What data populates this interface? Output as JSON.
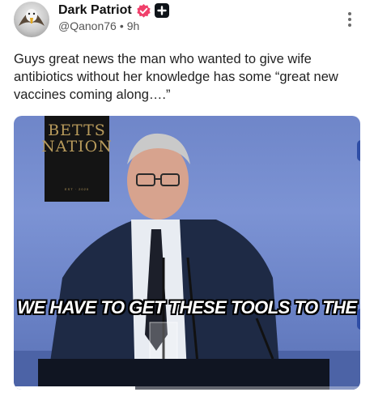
{
  "author": {
    "display_name": "Dark Patriot",
    "handle": "@Qanon76",
    "separator": "•",
    "time_ago": "9h",
    "avatar_icon": "eagle-avatar-icon",
    "verified_icon": "verified-badge-icon",
    "verified_color": "#f0406b",
    "plus_icon": "plus-badge-icon"
  },
  "post": {
    "text": "Guys great news the man who wanted to give wife antibiotics without her knowledge has some “great new vaccines coming along….”"
  },
  "media": {
    "logo_line1": "BETTS",
    "logo_line2": "NATION",
    "logo_sub": "EST · 2020",
    "caption": "WE HAVE TO GET THESE TOOLS TO THE",
    "background_color": "#7089cc",
    "progress": 0.35
  },
  "more_icon": "more-options-icon"
}
